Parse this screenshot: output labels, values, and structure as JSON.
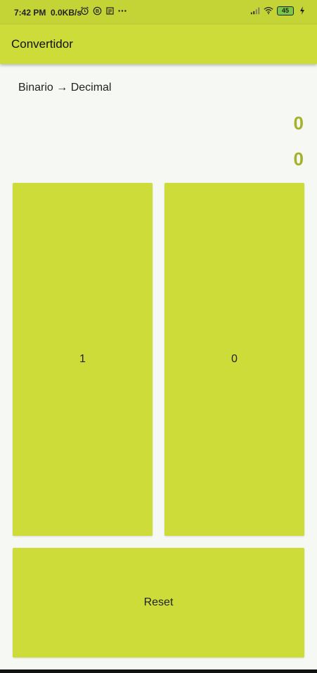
{
  "status_bar": {
    "time": "7:42 PM",
    "net_speed": "0.0KB/s",
    "battery": "45",
    "icons": [
      "alarm-icon",
      "b-icon",
      "notification-icon",
      "more-icon",
      "signal-icon",
      "wifi-icon",
      "battery-icon",
      "charging-icon"
    ]
  },
  "app_bar": {
    "title": "Convertidor"
  },
  "main": {
    "mode_label": "Binario → Decimal",
    "binary_value": "0",
    "decimal_value": "0",
    "value_color": "#a6b02a"
  },
  "buttons": {
    "one_label": "1",
    "zero_label": "0",
    "reset_label": "Reset"
  },
  "colors": {
    "accent": "#cddc39",
    "status_bar": "#c4d336",
    "background": "#f6f8f4"
  }
}
